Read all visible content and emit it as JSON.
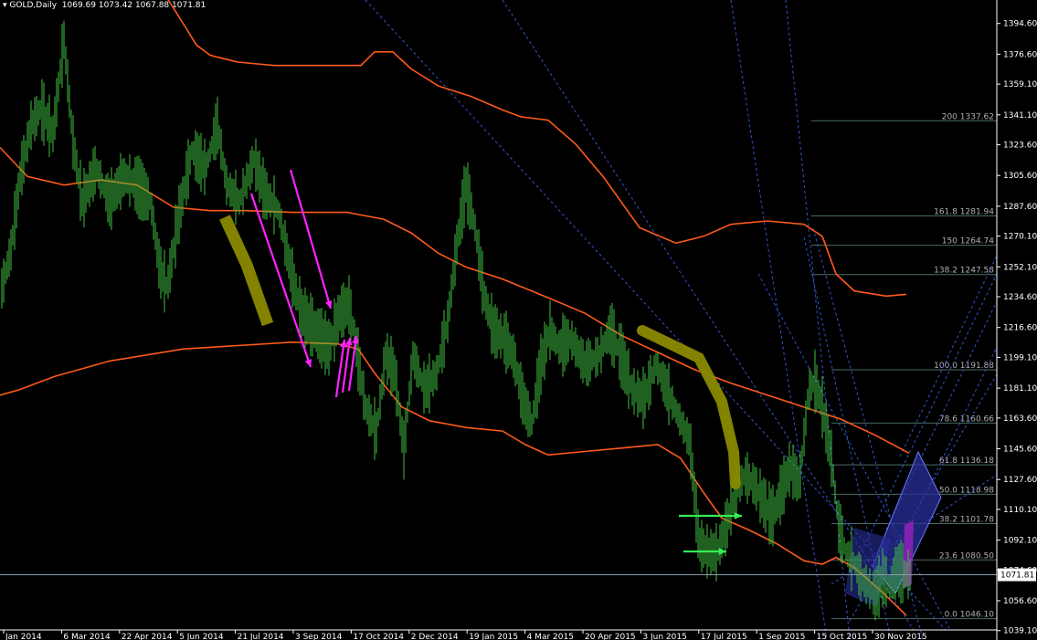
{
  "header": {
    "symbol": "GOLD,Daily",
    "ohlc": "1069.69 1073.42 1067.88 1071.81",
    "arrow_glyph": "▾"
  },
  "colors": {
    "background": "#000000",
    "candles": "#3fbf3f",
    "envelope": "#ff5a1a",
    "fib_lines": "#4a6a6a",
    "trendlines": "#3355cc",
    "axis_text": "#ffffff",
    "price_line": "#8a9aaa",
    "magenta": "#ff22ff",
    "green_arrow": "#33ee55",
    "olive": "#8a8a00"
  },
  "chart_data": {
    "type": "candlestick",
    "symbol": "GOLD",
    "timeframe": "Daily",
    "ylim": [
      1039.5,
      1403.0
    ],
    "y_ticks": [
      {
        "label": "1394.60",
        "value": 1394.6
      },
      {
        "label": "1376.60",
        "value": 1376.6
      },
      {
        "label": "1359.10",
        "value": 1359.1
      },
      {
        "label": "1341.10",
        "value": 1341.1
      },
      {
        "label": "1323.60",
        "value": 1323.6
      },
      {
        "label": "1305.60",
        "value": 1305.6
      },
      {
        "label": "1287.60",
        "value": 1287.6
      },
      {
        "label": "1270.10",
        "value": 1270.1
      },
      {
        "label": "1252.10",
        "value": 1252.1
      },
      {
        "label": "1234.60",
        "value": 1234.6
      },
      {
        "label": "1216.60",
        "value": 1216.6
      },
      {
        "label": "1199.10",
        "value": 1199.1
      },
      {
        "label": "1181.10",
        "value": 1181.1
      },
      {
        "label": "1163.60",
        "value": 1163.6
      },
      {
        "label": "1145.60",
        "value": 1145.6
      },
      {
        "label": "1127.60",
        "value": 1127.6
      },
      {
        "label": "1110.10",
        "value": 1110.1
      },
      {
        "label": "1092.10",
        "value": 1092.1
      },
      {
        "label": "1074.60",
        "value": 1074.6
      },
      {
        "label": "1056.60",
        "value": 1056.6
      },
      {
        "label": "1039.10",
        "value": 1039.1
      }
    ],
    "current_price": {
      "label": "1071.81",
      "value": 1071.81
    },
    "x_ticks": [
      "Jan 2014",
      "6 Mar 2014",
      "22 Apr 2014",
      "5 Jun 2014",
      "21 Jul 2014",
      "3 Sep 2014",
      "17 Oct 2014",
      "2 Dec 2014",
      "19 Jan 2015",
      "4 Mar 2015",
      "20 Apr 2015",
      "3 Jun 2015",
      "17 Jul 2015",
      "1 Sep 2015",
      "15 Oct 2015",
      "30 Nov 2015"
    ],
    "price_path": [
      [
        0,
        1235
      ],
      [
        12,
        1262
      ],
      [
        22,
        1305
      ],
      [
        34,
        1335
      ],
      [
        45,
        1345
      ],
      [
        58,
        1330
      ],
      [
        70,
        1385
      ],
      [
        80,
        1325
      ],
      [
        90,
        1290
      ],
      [
        105,
        1310
      ],
      [
        120,
        1290
      ],
      [
        135,
        1305
      ],
      [
        150,
        1300
      ],
      [
        165,
        1290
      ],
      [
        175,
        1250
      ],
      [
        183,
        1240
      ],
      [
        195,
        1280
      ],
      [
        210,
        1320
      ],
      [
        225,
        1310
      ],
      [
        238,
        1335
      ],
      [
        248,
        1300
      ],
      [
        262,
        1290
      ],
      [
        278,
        1315
      ],
      [
        290,
        1295
      ],
      [
        305,
        1285
      ],
      [
        318,
        1250
      ],
      [
        330,
        1225
      ],
      [
        345,
        1215
      ],
      [
        360,
        1205
      ],
      [
        372,
        1225
      ],
      [
        382,
        1230
      ],
      [
        390,
        1205
      ],
      [
        400,
        1170
      ],
      [
        412,
        1155
      ],
      [
        422,
        1200
      ],
      [
        432,
        1190
      ],
      [
        442,
        1145
      ],
      [
        452,
        1200
      ],
      [
        465,
        1180
      ],
      [
        478,
        1190
      ],
      [
        490,
        1220
      ],
      [
        500,
        1265
      ],
      [
        510,
        1300
      ],
      [
        520,
        1275
      ],
      [
        530,
        1235
      ],
      [
        540,
        1215
      ],
      [
        552,
        1210
      ],
      [
        562,
        1200
      ],
      [
        572,
        1175
      ],
      [
        582,
        1160
      ],
      [
        592,
        1195
      ],
      [
        602,
        1215
      ],
      [
        612,
        1205
      ],
      [
        625,
        1210
      ],
      [
        640,
        1195
      ],
      [
        655,
        1200
      ],
      [
        668,
        1215
      ],
      [
        680,
        1200
      ],
      [
        692,
        1180
      ],
      [
        705,
        1175
      ],
      [
        718,
        1195
      ],
      [
        730,
        1180
      ],
      [
        742,
        1165
      ],
      [
        755,
        1150
      ],
      [
        765,
        1090
      ],
      [
        775,
        1085
      ],
      [
        785,
        1085
      ],
      [
        795,
        1100
      ],
      [
        805,
        1120
      ],
      [
        815,
        1130
      ],
      [
        825,
        1125
      ],
      [
        835,
        1115
      ],
      [
        845,
        1105
      ],
      [
        855,
        1120
      ],
      [
        865,
        1135
      ],
      [
        875,
        1125
      ],
      [
        885,
        1180
      ],
      [
        892,
        1185
      ],
      [
        900,
        1170
      ],
      [
        910,
        1140
      ],
      [
        918,
        1100
      ],
      [
        926,
        1085
      ],
      [
        934,
        1080
      ],
      [
        942,
        1070
      ],
      [
        950,
        1065
      ],
      [
        958,
        1060
      ],
      [
        966,
        1070
      ],
      [
        974,
        1065
      ],
      [
        982,
        1075
      ],
      [
        990,
        1072
      ],
      [
        996,
        1072
      ]
    ],
    "envelope_upper": [
      [
        180,
        1412
      ],
      [
        200,
        1395
      ],
      [
        215,
        1382
      ],
      [
        230,
        1376
      ],
      [
        260,
        1372
      ],
      [
        300,
        1370
      ],
      [
        350,
        1370
      ],
      [
        395,
        1370
      ],
      [
        410,
        1378
      ],
      [
        430,
        1378
      ],
      [
        450,
        1368
      ],
      [
        480,
        1358
      ],
      [
        515,
        1352
      ],
      [
        550,
        1344
      ],
      [
        570,
        1340
      ],
      [
        600,
        1338
      ],
      [
        630,
        1324
      ],
      [
        660,
        1305
      ],
      [
        700,
        1275
      ],
      [
        740,
        1266
      ],
      [
        770,
        1270
      ],
      [
        800,
        1277
      ],
      [
        840,
        1279
      ],
      [
        880,
        1277
      ],
      [
        900,
        1270
      ],
      [
        915,
        1248
      ],
      [
        935,
        1238
      ],
      [
        970,
        1235
      ],
      [
        992,
        1236
      ]
    ],
    "envelope_middle": [
      [
        0,
        1322
      ],
      [
        30,
        1305
      ],
      [
        70,
        1300
      ],
      [
        110,
        1303
      ],
      [
        150,
        1300
      ],
      [
        190,
        1287
      ],
      [
        230,
        1285
      ],
      [
        270,
        1285
      ],
      [
        320,
        1284
      ],
      [
        380,
        1284
      ],
      [
        420,
        1280
      ],
      [
        450,
        1272
      ],
      [
        480,
        1260
      ],
      [
        510,
        1252
      ],
      [
        550,
        1245
      ],
      [
        600,
        1234
      ],
      [
        640,
        1225
      ],
      [
        680,
        1212
      ],
      [
        720,
        1202
      ],
      [
        760,
        1192
      ],
      [
        800,
        1184
      ],
      [
        840,
        1177
      ],
      [
        880,
        1170
      ],
      [
        920,
        1163
      ],
      [
        960,
        1153
      ],
      [
        995,
        1143
      ]
    ],
    "envelope_lower": [
      [
        0,
        1177
      ],
      [
        20,
        1180
      ],
      [
        60,
        1188
      ],
      [
        120,
        1197
      ],
      [
        200,
        1204
      ],
      [
        260,
        1206
      ],
      [
        320,
        1208
      ],
      [
        370,
        1207
      ],
      [
        392,
        1204
      ],
      [
        410,
        1190
      ],
      [
        440,
        1170
      ],
      [
        470,
        1162
      ],
      [
        510,
        1158
      ],
      [
        550,
        1156
      ],
      [
        575,
        1148
      ],
      [
        600,
        1142
      ],
      [
        640,
        1144
      ],
      [
        680,
        1146
      ],
      [
        720,
        1148
      ],
      [
        745,
        1140
      ],
      [
        770,
        1120
      ],
      [
        790,
        1105
      ],
      [
        820,
        1098
      ],
      [
        850,
        1090
      ],
      [
        880,
        1080
      ],
      [
        900,
        1078
      ],
      [
        915,
        1082
      ],
      [
        935,
        1076
      ],
      [
        965,
        1062
      ],
      [
        992,
        1048
      ]
    ],
    "fibonacci": {
      "price_zero": 1046.1,
      "price_hundred": 1191.9,
      "levels": [
        {
          "ratio": "0.0",
          "price": "1046.10",
          "value": 1046.1
        },
        {
          "ratio": "23.6",
          "price": "1080.50",
          "value": 1080.5
        },
        {
          "ratio": "38.2",
          "price": "1101.78",
          "value": 1101.78
        },
        {
          "ratio": "50.0",
          "price": "1118.98",
          "value": 1118.98
        },
        {
          "ratio": "61.8",
          "price": "1136.18",
          "value": 1136.18
        },
        {
          "ratio": "78.6",
          "price": "1160.66",
          "value": 1160.66
        },
        {
          "ratio": "100.0",
          "price": "1191.88",
          "value": 1191.88
        },
        {
          "ratio": "138.2",
          "price": "1247.58",
          "value": 1247.58
        },
        {
          "ratio": "150",
          "price": "1264.74",
          "value": 1264.74
        },
        {
          "ratio": "161.8",
          "price": "1281.94",
          "value": 1281.94
        },
        {
          "ratio": "200",
          "price": "1337.62",
          "value": 1337.62
        }
      ]
    },
    "grid": false,
    "legend": "none"
  }
}
